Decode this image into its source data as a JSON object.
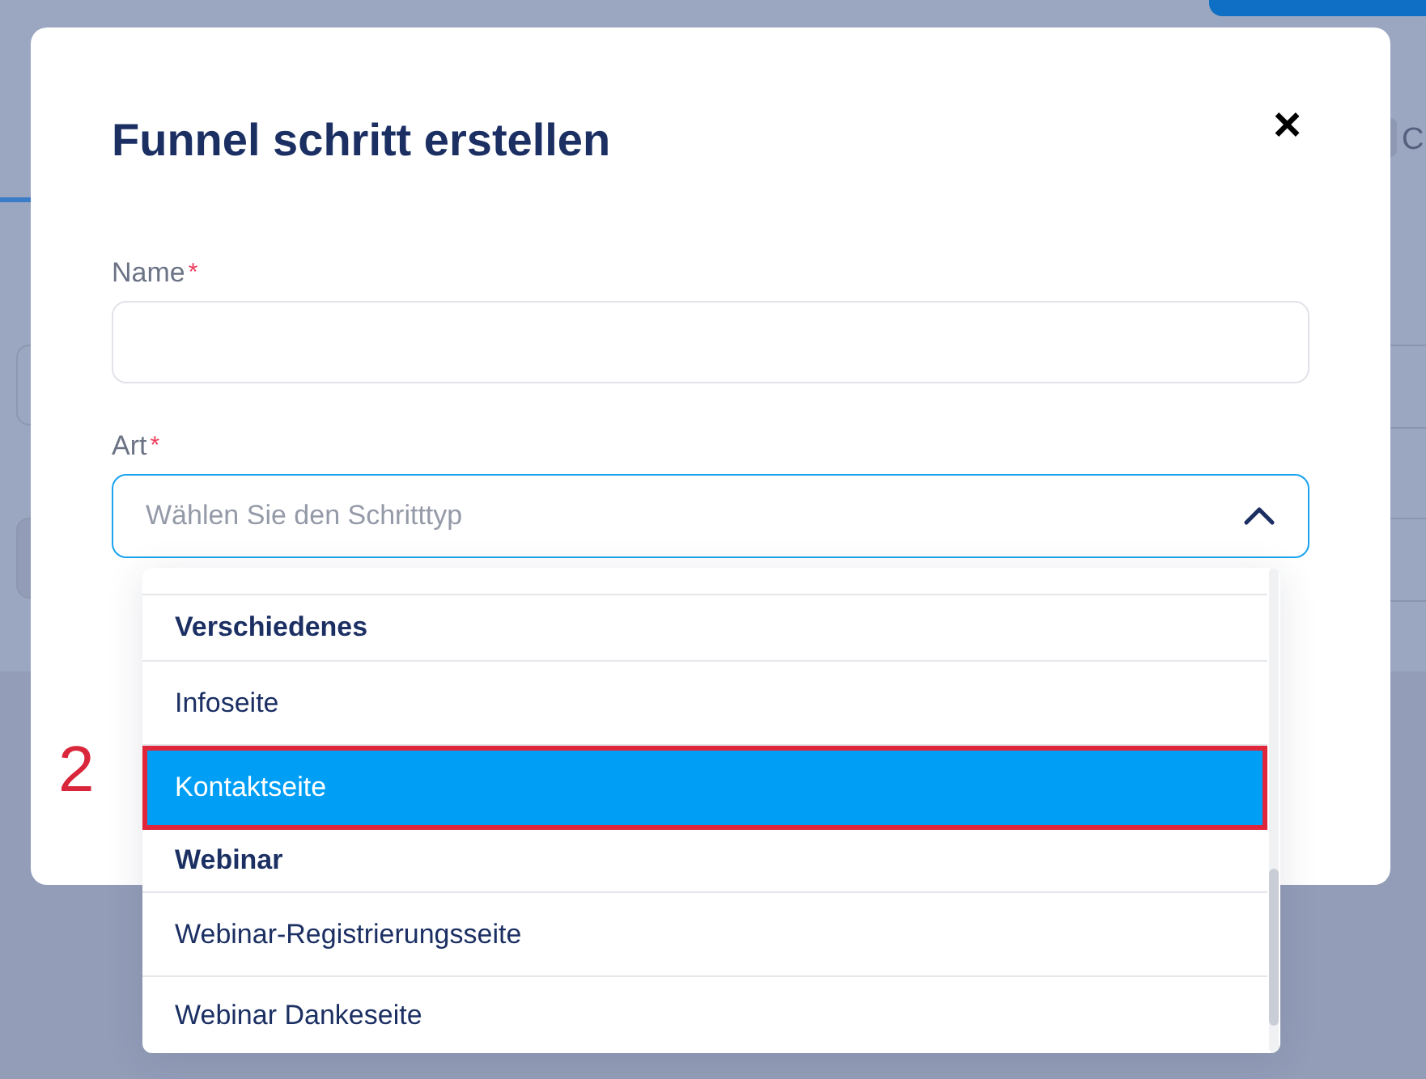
{
  "background": {
    "labels": [
      "C"
    ]
  },
  "dialog": {
    "title": "Funnel schritt erstellen",
    "close": "×",
    "fields": [
      {
        "kind": "text",
        "label": "Name",
        "required_mark": "*"
      },
      {
        "kind": "select",
        "label": "Art",
        "required_mark": "*",
        "placeholder": "Wählen Sie den Schritttyp",
        "expanded": true
      }
    ]
  },
  "dropdown": {
    "options": [
      {
        "kind": "group",
        "label": "Verschiedenes"
      },
      {
        "kind": "option",
        "label": "Infoseite",
        "selected": false
      },
      {
        "kind": "option",
        "label": "Kontaktseite",
        "selected": true,
        "annotated": true
      },
      {
        "kind": "group",
        "label": "Webinar"
      },
      {
        "kind": "option",
        "label": "Webinar-Registrierungsseite",
        "selected": false
      },
      {
        "kind": "option",
        "label": "Webinar Dankeseite",
        "selected": false
      }
    ]
  },
  "annotation": {
    "label": "2"
  }
}
